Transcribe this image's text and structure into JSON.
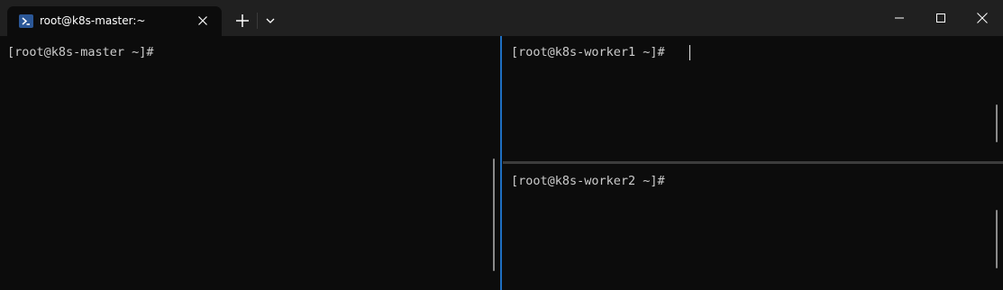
{
  "window": {
    "tab_title": "root@k8s-master:~",
    "tab_icon": "powershell-icon",
    "new_tab_icon": "plus-icon",
    "dropdown_icon": "chevron-down-icon",
    "minimize_icon": "minimize-icon",
    "maximize_icon": "maximize-icon",
    "close_icon": "close-icon"
  },
  "panes": {
    "master": {
      "prompt": "[root@k8s-master ~]#"
    },
    "worker1": {
      "prompt": "[root@k8s-worker1 ~]#"
    },
    "worker2": {
      "prompt": "[root@k8s-worker2 ~]#"
    }
  },
  "colors": {
    "background": "#0c0c0c",
    "titlebar": "#202020",
    "focus_accent": "#1e6fc2",
    "text": "#cccccc"
  }
}
